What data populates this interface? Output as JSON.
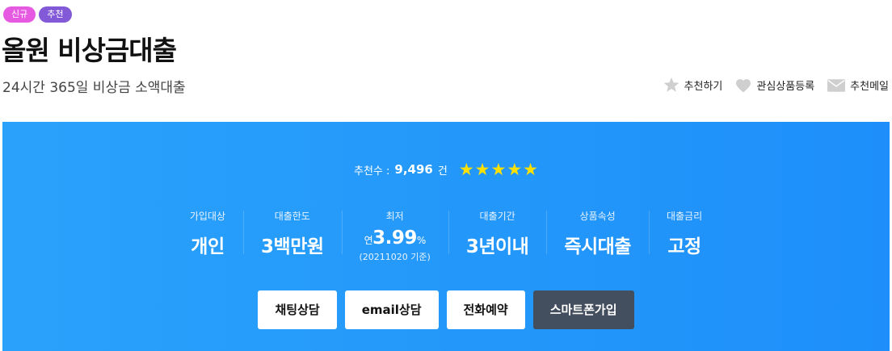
{
  "badges": {
    "new": "신규",
    "recommend": "추천"
  },
  "title": "올원 비상금대출",
  "subtitle": "24시간 365일 비상금 소액대출",
  "actions": {
    "recommend": "추천하기",
    "favorite": "관심상품등록",
    "mail": "추천메일"
  },
  "recommend": {
    "label": "추천수 :",
    "count": "9,496",
    "unit": "건",
    "rating": 5
  },
  "stats": {
    "target": {
      "label": "가입대상",
      "value": "개인"
    },
    "limit": {
      "label": "대출한도",
      "value": "3백만원"
    },
    "min_rate": {
      "label": "최저",
      "prefix": "연",
      "value": "3.99",
      "unit": "%",
      "note": "(20211020 기준)"
    },
    "period": {
      "label": "대출기간",
      "value": "3년이내"
    },
    "attribute": {
      "label": "상품속성",
      "value": "즉시대출"
    },
    "rate_type": {
      "label": "대출금리",
      "value": "고정"
    }
  },
  "buttons": {
    "chat": "채팅상담",
    "email": "email상담",
    "phone": "전화예약",
    "smartphone": "스마트폰가입"
  },
  "colors": {
    "panel": "#1e8ffa",
    "star": "#ffe100",
    "dark_button": "#434e5e",
    "badge_new": "#e55ae0",
    "badge_recommend": "#8259d6"
  }
}
